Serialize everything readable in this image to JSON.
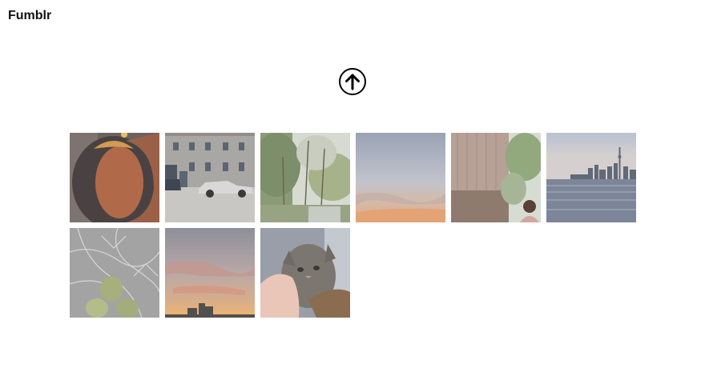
{
  "header": {
    "app_title": "Fumblr"
  },
  "upload": {
    "icon": "arrow-up-circle-icon"
  },
  "gallery": {
    "photos": [
      {
        "subject": "dark-orange-object"
      },
      {
        "subject": "street-building-car"
      },
      {
        "subject": "trees-forest"
      },
      {
        "subject": "sunset-sky"
      },
      {
        "subject": "person-wall-tree"
      },
      {
        "subject": "city-skyline-water"
      },
      {
        "subject": "plant-buds-branches"
      },
      {
        "subject": "sunset-clouds-building"
      },
      {
        "subject": "kitten-in-hand"
      }
    ]
  }
}
